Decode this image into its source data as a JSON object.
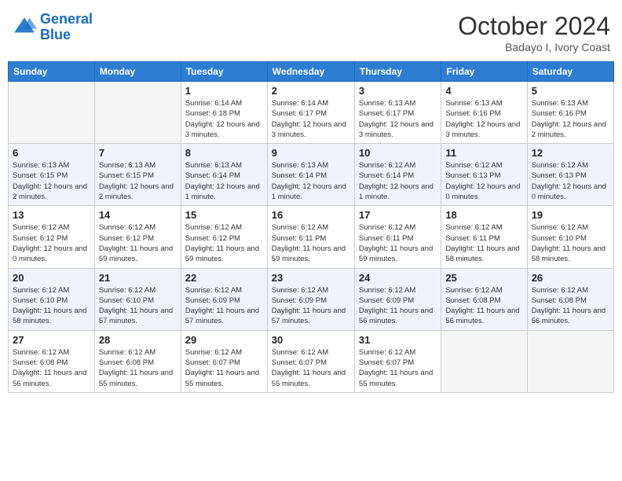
{
  "header": {
    "logo_line1": "General",
    "logo_line2": "Blue",
    "month_title": "October 2024",
    "location": "Badayo I, Ivory Coast"
  },
  "weekdays": [
    "Sunday",
    "Monday",
    "Tuesday",
    "Wednesday",
    "Thursday",
    "Friday",
    "Saturday"
  ],
  "weeks": [
    [
      {
        "day": "",
        "info": ""
      },
      {
        "day": "",
        "info": ""
      },
      {
        "day": "1",
        "info": "Sunrise: 6:14 AM\nSunset: 6:18 PM\nDaylight: 12 hours and 3 minutes."
      },
      {
        "day": "2",
        "info": "Sunrise: 6:14 AM\nSunset: 6:17 PM\nDaylight: 12 hours and 3 minutes."
      },
      {
        "day": "3",
        "info": "Sunrise: 6:13 AM\nSunset: 6:17 PM\nDaylight: 12 hours and 3 minutes."
      },
      {
        "day": "4",
        "info": "Sunrise: 6:13 AM\nSunset: 6:16 PM\nDaylight: 12 hours and 3 minutes."
      },
      {
        "day": "5",
        "info": "Sunrise: 6:13 AM\nSunset: 6:16 PM\nDaylight: 12 hours and 2 minutes."
      }
    ],
    [
      {
        "day": "6",
        "info": "Sunrise: 6:13 AM\nSunset: 6:15 PM\nDaylight: 12 hours and 2 minutes."
      },
      {
        "day": "7",
        "info": "Sunrise: 6:13 AM\nSunset: 6:15 PM\nDaylight: 12 hours and 2 minutes."
      },
      {
        "day": "8",
        "info": "Sunrise: 6:13 AM\nSunset: 6:14 PM\nDaylight: 12 hours and 1 minute."
      },
      {
        "day": "9",
        "info": "Sunrise: 6:13 AM\nSunset: 6:14 PM\nDaylight: 12 hours and 1 minute."
      },
      {
        "day": "10",
        "info": "Sunrise: 6:12 AM\nSunset: 6:14 PM\nDaylight: 12 hours and 1 minute."
      },
      {
        "day": "11",
        "info": "Sunrise: 6:12 AM\nSunset: 6:13 PM\nDaylight: 12 hours and 0 minutes."
      },
      {
        "day": "12",
        "info": "Sunrise: 6:12 AM\nSunset: 6:13 PM\nDaylight: 12 hours and 0 minutes."
      }
    ],
    [
      {
        "day": "13",
        "info": "Sunrise: 6:12 AM\nSunset: 6:12 PM\nDaylight: 12 hours and 0 minutes."
      },
      {
        "day": "14",
        "info": "Sunrise: 6:12 AM\nSunset: 6:12 PM\nDaylight: 11 hours and 59 minutes."
      },
      {
        "day": "15",
        "info": "Sunrise: 6:12 AM\nSunset: 6:12 PM\nDaylight: 11 hours and 59 minutes."
      },
      {
        "day": "16",
        "info": "Sunrise: 6:12 AM\nSunset: 6:11 PM\nDaylight: 11 hours and 59 minutes."
      },
      {
        "day": "17",
        "info": "Sunrise: 6:12 AM\nSunset: 6:11 PM\nDaylight: 11 hours and 59 minutes."
      },
      {
        "day": "18",
        "info": "Sunrise: 6:12 AM\nSunset: 6:11 PM\nDaylight: 11 hours and 58 minutes."
      },
      {
        "day": "19",
        "info": "Sunrise: 6:12 AM\nSunset: 6:10 PM\nDaylight: 11 hours and 58 minutes."
      }
    ],
    [
      {
        "day": "20",
        "info": "Sunrise: 6:12 AM\nSunset: 6:10 PM\nDaylight: 11 hours and 58 minutes."
      },
      {
        "day": "21",
        "info": "Sunrise: 6:12 AM\nSunset: 6:10 PM\nDaylight: 11 hours and 57 minutes."
      },
      {
        "day": "22",
        "info": "Sunrise: 6:12 AM\nSunset: 6:09 PM\nDaylight: 11 hours and 57 minutes."
      },
      {
        "day": "23",
        "info": "Sunrise: 6:12 AM\nSunset: 6:09 PM\nDaylight: 11 hours and 57 minutes."
      },
      {
        "day": "24",
        "info": "Sunrise: 6:12 AM\nSunset: 6:09 PM\nDaylight: 11 hours and 56 minutes."
      },
      {
        "day": "25",
        "info": "Sunrise: 6:12 AM\nSunset: 6:08 PM\nDaylight: 11 hours and 56 minutes."
      },
      {
        "day": "26",
        "info": "Sunrise: 6:12 AM\nSunset: 6:08 PM\nDaylight: 11 hours and 56 minutes."
      }
    ],
    [
      {
        "day": "27",
        "info": "Sunrise: 6:12 AM\nSunset: 6:08 PM\nDaylight: 11 hours and 56 minutes."
      },
      {
        "day": "28",
        "info": "Sunrise: 6:12 AM\nSunset: 6:08 PM\nDaylight: 11 hours and 55 minutes."
      },
      {
        "day": "29",
        "info": "Sunrise: 6:12 AM\nSunset: 6:07 PM\nDaylight: 11 hours and 55 minutes."
      },
      {
        "day": "30",
        "info": "Sunrise: 6:12 AM\nSunset: 6:07 PM\nDaylight: 11 hours and 55 minutes."
      },
      {
        "day": "31",
        "info": "Sunrise: 6:12 AM\nSunset: 6:07 PM\nDaylight: 11 hours and 55 minutes."
      },
      {
        "day": "",
        "info": ""
      },
      {
        "day": "",
        "info": ""
      }
    ]
  ]
}
